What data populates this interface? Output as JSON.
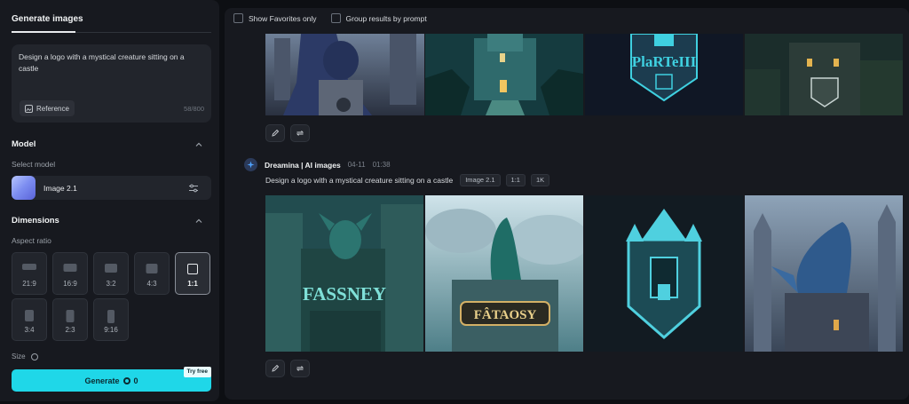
{
  "left_panel": {
    "tab_title": "Generate images",
    "prompt": {
      "text": "Design a logo with a mystical creature sitting on a castle",
      "reference_label": "Reference",
      "char_count": "58/800"
    },
    "model_section": {
      "title": "Model",
      "select_label": "Select model",
      "selected_model": "Image 2.1"
    },
    "dimensions_section": {
      "title": "Dimensions",
      "aspect_label": "Aspect ratio",
      "ratios": [
        "21:9",
        "16:9",
        "3:2",
        "4:3",
        "1:1",
        "3:4",
        "2:3",
        "9:16"
      ],
      "selected_ratio": "1:1",
      "size_label": "Size"
    },
    "generate": {
      "label": "Generate",
      "cost": "0",
      "badge": "Try free"
    }
  },
  "toolbar": {
    "show_favorites": "Show Favorites only",
    "group_results": "Group results by prompt"
  },
  "generation": {
    "author": "Dreamina | AI images",
    "date": "04-11",
    "time": "01:38",
    "prompt": "Design a logo with a mystical creature sitting on a castle",
    "tags": [
      "Image 2.1",
      "1:1",
      "1K"
    ]
  },
  "image_texts": {
    "top_logo": "PlaRTeIII",
    "bottom_1": "FASSNEY",
    "bottom_2": "FÂTAOSY"
  },
  "colors": {
    "accent": "#1fd7e8",
    "panel": "#17191f",
    "background": "#0d0f13"
  }
}
